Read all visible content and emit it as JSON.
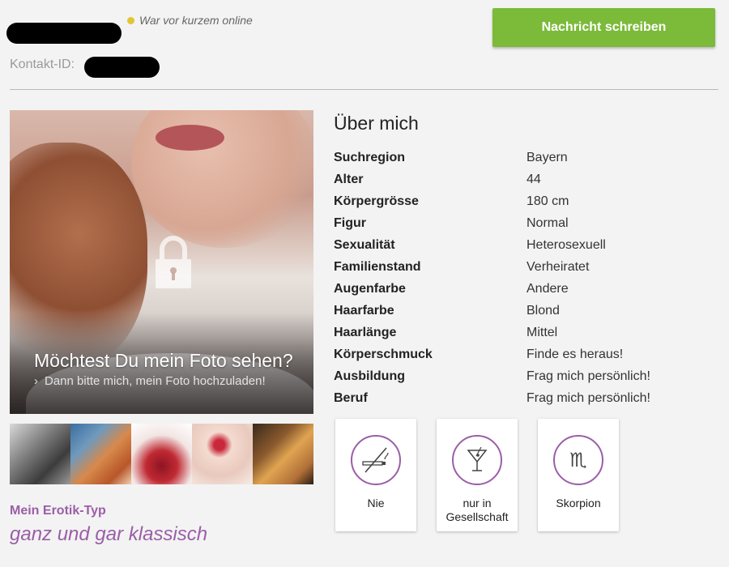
{
  "header": {
    "online_status": "War vor kurzem online",
    "contact_label": "Kontakt-ID:",
    "message_button": "Nachricht schreiben"
  },
  "photo": {
    "title": "Möchtest Du mein Foto sehen?",
    "subtitle": "Dann bitte mich, mein Foto hochzuladen!"
  },
  "erotik": {
    "label": "Mein Erotik-Typ",
    "value": "ganz und gar klassisch"
  },
  "about": {
    "title": "Über mich",
    "rows": [
      {
        "key": "Suchregion",
        "value": "Bayern"
      },
      {
        "key": "Alter",
        "value": "44"
      },
      {
        "key": "Körpergrösse",
        "value": "180 cm"
      },
      {
        "key": "Figur",
        "value": "Normal"
      },
      {
        "key": "Sexualität",
        "value": "Heterosexuell"
      },
      {
        "key": "Familienstand",
        "value": "Verheiratet"
      },
      {
        "key": "Augenfarbe",
        "value": "Andere"
      },
      {
        "key": "Haarfarbe",
        "value": "Blond"
      },
      {
        "key": "Haarlänge",
        "value": "Mittel"
      },
      {
        "key": "Körperschmuck",
        "value": "Finde es heraus!"
      },
      {
        "key": "Ausbildung",
        "value": "Frag mich persönlich!"
      },
      {
        "key": "Beruf",
        "value": "Frag mich persönlich!"
      }
    ]
  },
  "cards": [
    {
      "icon": "no-smoking-icon",
      "label": "Nie"
    },
    {
      "icon": "cocktail-icon",
      "label": "nur in Gesellschaft"
    },
    {
      "icon": "scorpio-icon",
      "label": "Skorpion"
    }
  ],
  "colors": {
    "accent_green": "#7cba3a",
    "accent_purple": "#9b5ea8",
    "online_dot": "#e4c431"
  }
}
